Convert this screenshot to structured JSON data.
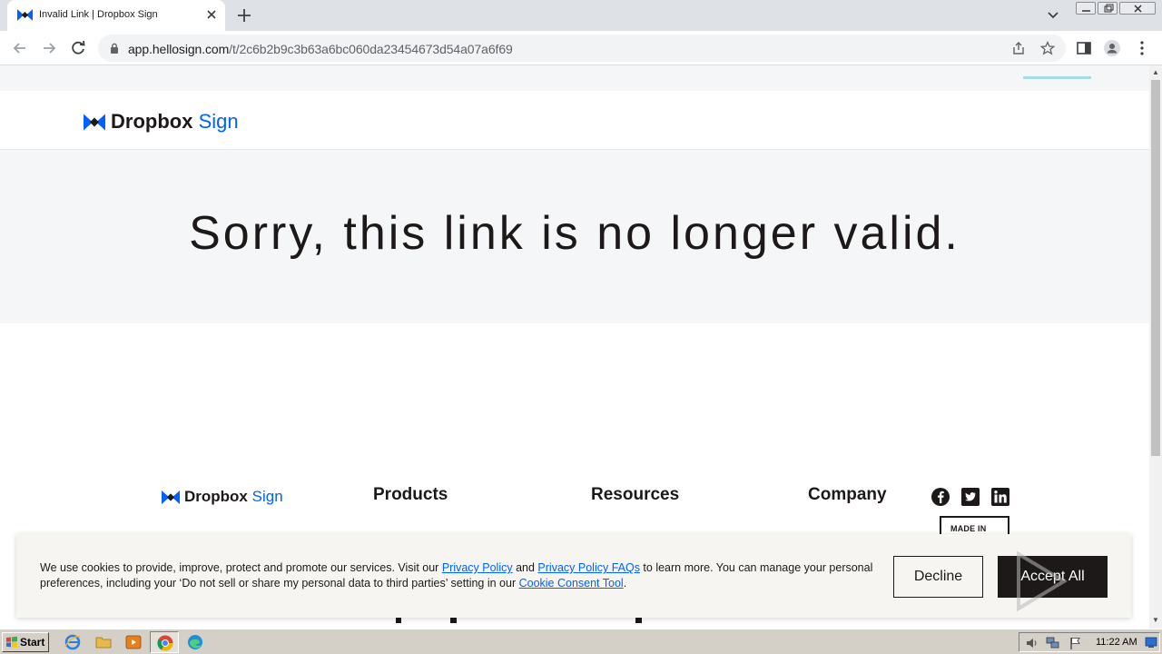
{
  "browser": {
    "tab_title": "Invalid Link | Dropbox Sign",
    "url_host": "app.hellosign.com",
    "url_path": "/t/2c6b2b9c3b63a6bc060da23454673d54a07a6f69"
  },
  "page": {
    "logo_main": "Dropbox",
    "logo_accent": "Sign",
    "hero_title": "Sorry, this link is no longer valid.",
    "footer": {
      "logo_main": "Dropbox",
      "logo_accent": "Sign",
      "columns": [
        "Products",
        "Resources",
        "Company"
      ],
      "badge": "MADE IN"
    }
  },
  "cookie_banner": {
    "text_1": "We use cookies to provide, improve, protect and promote our services. Visit our ",
    "link_privacy": "Privacy Policy",
    "text_2": " and ",
    "link_faqs": "Privacy Policy FAQs",
    "text_3": " to learn more. You can manage your personal preferences, including your ‘Do not sell or share my personal data to third parties’ setting in our ",
    "link_consent": "Cookie Consent Tool",
    "text_4": ".",
    "decline_label": "Decline",
    "accept_label": "Accept All"
  },
  "taskbar": {
    "start_label": "Start",
    "clock": "11:22 AM"
  },
  "colors": {
    "brand_blue": "#0061fe",
    "ink": "#1e1919",
    "hero_bg": "#f5f6f8"
  }
}
